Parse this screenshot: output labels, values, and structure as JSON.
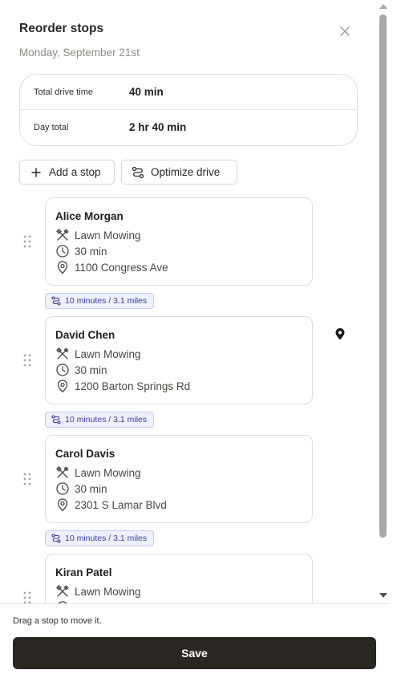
{
  "header": {
    "title": "Reorder stops",
    "date": "Monday, September 21st",
    "close_icon": "close-icon"
  },
  "summary": {
    "total_drive_label": "Total drive time",
    "total_drive_value": "40 min",
    "day_total_label": "Day total",
    "day_total_value": "2 hr 40 min"
  },
  "actions": {
    "add_stop_label": "Add a stop",
    "add_stop_icon": "plus-icon",
    "optimize_label": "Optimize drive",
    "optimize_icon": "route-icon"
  },
  "stops": [
    {
      "name": "Alice Morgan",
      "service": "Lawn Mowing",
      "duration": "30 min",
      "address": "1100 Congress Ave"
    },
    {
      "name": "David Chen",
      "service": "Lawn Mowing",
      "duration": "30 min",
      "address": "1200 Barton Springs Rd"
    },
    {
      "name": "Carol Davis",
      "service": "Lawn Mowing",
      "duration": "30 min",
      "address": "2301 S Lamar Blvd"
    },
    {
      "name": "Kiran Patel",
      "service": "Lawn Mowing",
      "duration": "",
      "address": ""
    }
  ],
  "drive_segments": [
    {
      "label": "10 minutes / 3.1 miles"
    },
    {
      "label": "10 minutes / 3.1 miles"
    },
    {
      "label": "10 minutes / 3.1 miles"
    }
  ],
  "footer": {
    "hint": "Drag a stop to move it.",
    "save_label": "Save"
  },
  "colors": {
    "primary_button": "#2a2723",
    "drive_badge_bg": "#eef0fd",
    "drive_badge_text": "#3a3e9a",
    "border": "#e1ddd8"
  }
}
